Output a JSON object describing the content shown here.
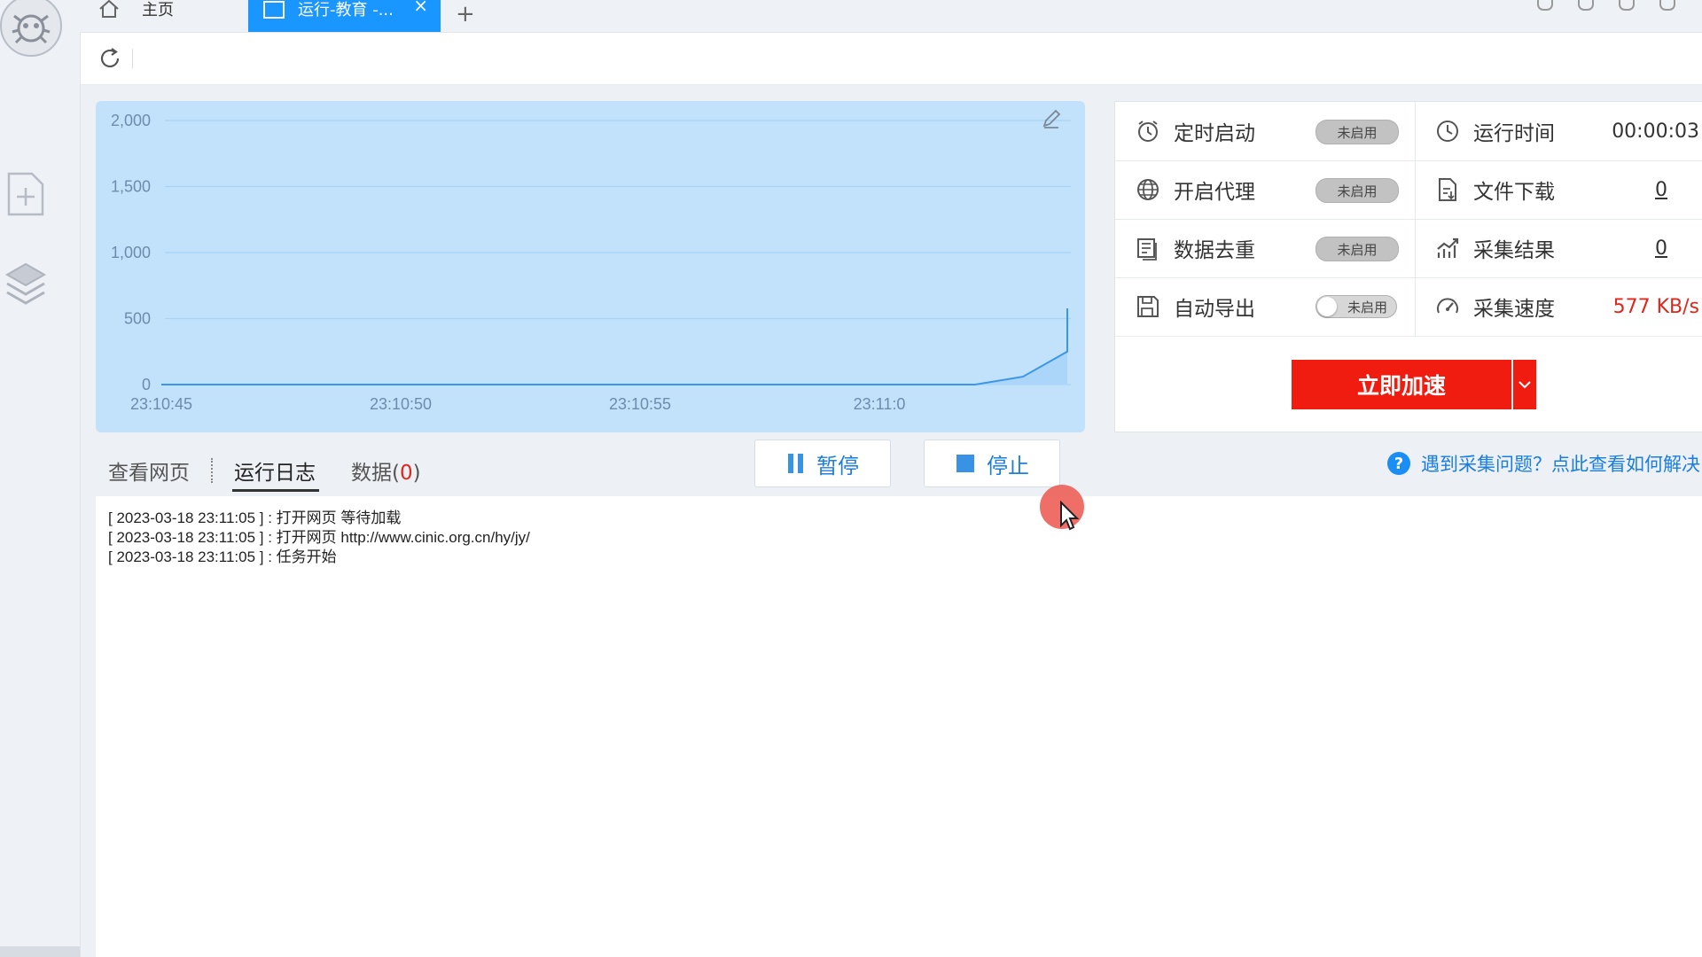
{
  "tabs": {
    "home_label": "主页",
    "run_label": "运行-教育 -...",
    "close_glyph": "×",
    "add_glyph": "+"
  },
  "chart_data": {
    "type": "area",
    "title": "",
    "xlabel": "",
    "ylabel": "",
    "x_ticks": [
      "23:10:45",
      "23:10:50",
      "23:10:55",
      "23:11:0"
    ],
    "y_ticks": [
      "2,000",
      "1,500",
      "1,000",
      "500",
      "0"
    ],
    "ylim": [
      0,
      2000
    ],
    "grid": true,
    "series": [
      {
        "x": [
          "23:10:45",
          "23:10:50",
          "23:10:55",
          "23:11:00",
          "23:11:02",
          "23:11:03",
          "23:11:04",
          "23:11:05"
        ],
        "values": [
          0,
          0,
          0,
          0,
          0,
          60,
          250,
          577
        ]
      }
    ],
    "colors": {
      "fill": "#a9d5fa",
      "line": "#3b97e6",
      "grid": "#a9d3f5",
      "bg": "#c2e2fb"
    }
  },
  "stats": {
    "rows": [
      {
        "left_icon": "alarm-clock-icon",
        "left_label": "定时启动",
        "left_status": "未启用",
        "right_icon": "clock-icon",
        "right_label": "运行时间",
        "right_value": "00:00:03"
      },
      {
        "left_icon": "globe-icon",
        "left_label": "开启代理",
        "left_status": "未启用",
        "right_icon": "file-download-icon",
        "right_label": "文件下载",
        "right_value": "0"
      },
      {
        "left_icon": "dedupe-list-icon",
        "left_label": "数据去重",
        "left_status": "未启用",
        "right_icon": "chart-trend-icon",
        "right_label": "采集结果",
        "right_value": "0"
      },
      {
        "left_icon": "save-export-icon",
        "left_label": "自动导出",
        "left_status": "未启用",
        "right_icon": "speedometer-icon",
        "right_label": "采集速度",
        "right_value": "577 KB/s"
      }
    ],
    "accelerate_label": "立即加速"
  },
  "view_tabs": {
    "webpage": "查看网页",
    "log": "运行日志",
    "data_prefix": "数据(",
    "data_count": "0",
    "data_suffix": ")"
  },
  "controls": {
    "pause_label": "暂停",
    "stop_label": "停止"
  },
  "help": {
    "text": "遇到采集问题？点此查看如何解决"
  },
  "log": [
    "[ 2023-03-18 23:11:05 ] : 打开网页 等待加载",
    "[ 2023-03-18 23:11:05 ] : 打开网页 http://www.cinic.org.cn/hy/jy/",
    "[ 2023-03-18 23:11:05 ] : 任务开始"
  ]
}
